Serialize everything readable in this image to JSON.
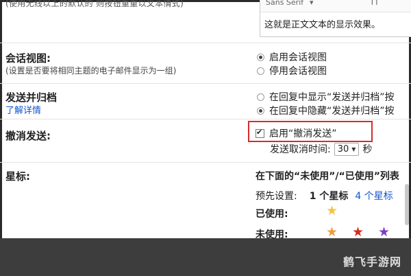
{
  "top": {
    "cut_text": "(使用无线以上的默认的 则按钮重重以文本情式)",
    "font_toolbar": {
      "font": "Sans Serif",
      "size_icon": "TT",
      "more": "▾"
    },
    "preview_text": "这就是正文文本的显示效果。"
  },
  "conversation_view": {
    "label": "会话视图:",
    "description": "(设置是否要将相同主题的电子邮件显示为一组)",
    "options": [
      "启用会话视图",
      "停用会话视图"
    ]
  },
  "send_archive": {
    "label": "发送并归档",
    "link": "了解详情",
    "options": [
      "在回复中显示“发送并归档”按",
      "在回复中隐藏“发送并归档”按"
    ]
  },
  "undo_send": {
    "label": "撤消发送:",
    "checkbox_label": "启用“撤消发送”",
    "cancel_period_label": "发送取消时间:",
    "cancel_period_value": "30",
    "unit": "秒"
  },
  "stars": {
    "label": "星标:",
    "instruction": "在下面的“未使用”/“已使用”列表",
    "preset_label": "预先设置:",
    "preset_one": "1 个星标",
    "preset_four": "4 个星标",
    "used_label": "已使用:",
    "unused_label": "未使用:"
  },
  "watermark": "鹤飞手游网",
  "colors": {
    "highlight": "#d62b2b",
    "link": "#1155cc",
    "star_yellow": "#f4c542",
    "star_orange": "#f29c38",
    "star_red": "#d72a1c",
    "star_purple": "#7d3ec5"
  }
}
